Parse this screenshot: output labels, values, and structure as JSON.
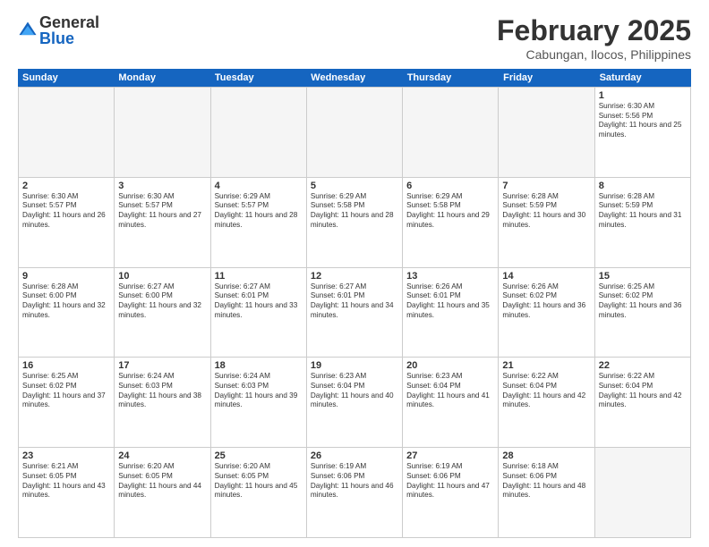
{
  "logo": {
    "general": "General",
    "blue": "Blue"
  },
  "title": "February 2025",
  "location": "Cabungan, Ilocos, Philippines",
  "days_header": [
    "Sunday",
    "Monday",
    "Tuesday",
    "Wednesday",
    "Thursday",
    "Friday",
    "Saturday"
  ],
  "weeks": [
    [
      {
        "day": "",
        "info": ""
      },
      {
        "day": "",
        "info": ""
      },
      {
        "day": "",
        "info": ""
      },
      {
        "day": "",
        "info": ""
      },
      {
        "day": "",
        "info": ""
      },
      {
        "day": "",
        "info": ""
      },
      {
        "day": "1",
        "info": "Sunrise: 6:30 AM\nSunset: 5:56 PM\nDaylight: 11 hours and 25 minutes."
      }
    ],
    [
      {
        "day": "2",
        "info": "Sunrise: 6:30 AM\nSunset: 5:57 PM\nDaylight: 11 hours and 26 minutes."
      },
      {
        "day": "3",
        "info": "Sunrise: 6:30 AM\nSunset: 5:57 PM\nDaylight: 11 hours and 27 minutes."
      },
      {
        "day": "4",
        "info": "Sunrise: 6:29 AM\nSunset: 5:57 PM\nDaylight: 11 hours and 28 minutes."
      },
      {
        "day": "5",
        "info": "Sunrise: 6:29 AM\nSunset: 5:58 PM\nDaylight: 11 hours and 28 minutes."
      },
      {
        "day": "6",
        "info": "Sunrise: 6:29 AM\nSunset: 5:58 PM\nDaylight: 11 hours and 29 minutes."
      },
      {
        "day": "7",
        "info": "Sunrise: 6:28 AM\nSunset: 5:59 PM\nDaylight: 11 hours and 30 minutes."
      },
      {
        "day": "8",
        "info": "Sunrise: 6:28 AM\nSunset: 5:59 PM\nDaylight: 11 hours and 31 minutes."
      }
    ],
    [
      {
        "day": "9",
        "info": "Sunrise: 6:28 AM\nSunset: 6:00 PM\nDaylight: 11 hours and 32 minutes."
      },
      {
        "day": "10",
        "info": "Sunrise: 6:27 AM\nSunset: 6:00 PM\nDaylight: 11 hours and 32 minutes."
      },
      {
        "day": "11",
        "info": "Sunrise: 6:27 AM\nSunset: 6:01 PM\nDaylight: 11 hours and 33 minutes."
      },
      {
        "day": "12",
        "info": "Sunrise: 6:27 AM\nSunset: 6:01 PM\nDaylight: 11 hours and 34 minutes."
      },
      {
        "day": "13",
        "info": "Sunrise: 6:26 AM\nSunset: 6:01 PM\nDaylight: 11 hours and 35 minutes."
      },
      {
        "day": "14",
        "info": "Sunrise: 6:26 AM\nSunset: 6:02 PM\nDaylight: 11 hours and 36 minutes."
      },
      {
        "day": "15",
        "info": "Sunrise: 6:25 AM\nSunset: 6:02 PM\nDaylight: 11 hours and 36 minutes."
      }
    ],
    [
      {
        "day": "16",
        "info": "Sunrise: 6:25 AM\nSunset: 6:02 PM\nDaylight: 11 hours and 37 minutes."
      },
      {
        "day": "17",
        "info": "Sunrise: 6:24 AM\nSunset: 6:03 PM\nDaylight: 11 hours and 38 minutes."
      },
      {
        "day": "18",
        "info": "Sunrise: 6:24 AM\nSunset: 6:03 PM\nDaylight: 11 hours and 39 minutes."
      },
      {
        "day": "19",
        "info": "Sunrise: 6:23 AM\nSunset: 6:04 PM\nDaylight: 11 hours and 40 minutes."
      },
      {
        "day": "20",
        "info": "Sunrise: 6:23 AM\nSunset: 6:04 PM\nDaylight: 11 hours and 41 minutes."
      },
      {
        "day": "21",
        "info": "Sunrise: 6:22 AM\nSunset: 6:04 PM\nDaylight: 11 hours and 42 minutes."
      },
      {
        "day": "22",
        "info": "Sunrise: 6:22 AM\nSunset: 6:04 PM\nDaylight: 11 hours and 42 minutes."
      }
    ],
    [
      {
        "day": "23",
        "info": "Sunrise: 6:21 AM\nSunset: 6:05 PM\nDaylight: 11 hours and 43 minutes."
      },
      {
        "day": "24",
        "info": "Sunrise: 6:20 AM\nSunset: 6:05 PM\nDaylight: 11 hours and 44 minutes."
      },
      {
        "day": "25",
        "info": "Sunrise: 6:20 AM\nSunset: 6:05 PM\nDaylight: 11 hours and 45 minutes."
      },
      {
        "day": "26",
        "info": "Sunrise: 6:19 AM\nSunset: 6:06 PM\nDaylight: 11 hours and 46 minutes."
      },
      {
        "day": "27",
        "info": "Sunrise: 6:19 AM\nSunset: 6:06 PM\nDaylight: 11 hours and 47 minutes."
      },
      {
        "day": "28",
        "info": "Sunrise: 6:18 AM\nSunset: 6:06 PM\nDaylight: 11 hours and 48 minutes."
      },
      {
        "day": "",
        "info": ""
      }
    ]
  ]
}
